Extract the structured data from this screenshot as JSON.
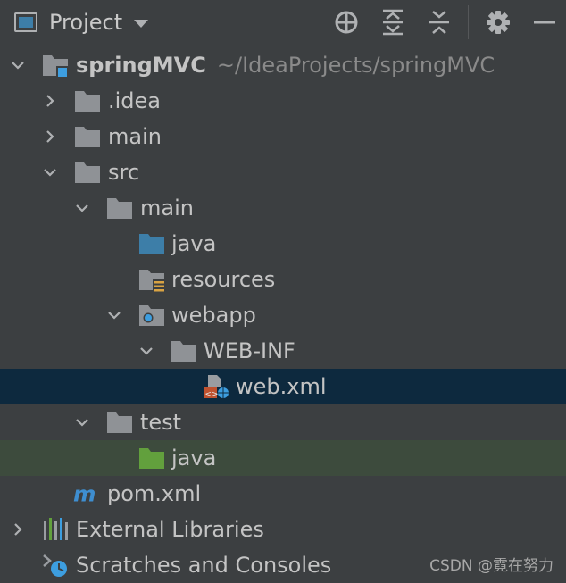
{
  "header": {
    "title": "Project",
    "icons": [
      "locate-icon",
      "expand-all-icon",
      "collapse-all-icon",
      "gear-icon",
      "minimize-icon"
    ]
  },
  "tree": [
    {
      "label": "springMVC",
      "path": "~/IdeaProjects/springMVC",
      "icon": "module-folder-icon",
      "expanded": true
    },
    {
      "label": ".idea",
      "icon": "folder-icon",
      "expanded": false
    },
    {
      "label": "main",
      "icon": "folder-icon",
      "expanded": false
    },
    {
      "label": "src",
      "icon": "folder-icon",
      "expanded": true
    },
    {
      "label": "main",
      "icon": "folder-icon",
      "expanded": true
    },
    {
      "label": "java",
      "icon": "source-folder-icon"
    },
    {
      "label": "resources",
      "icon": "resources-folder-icon"
    },
    {
      "label": "webapp",
      "icon": "web-folder-icon",
      "expanded": true
    },
    {
      "label": "WEB-INF",
      "icon": "folder-icon",
      "expanded": true
    },
    {
      "label": "web.xml",
      "icon": "web-xml-icon",
      "selected": true
    },
    {
      "label": "test",
      "icon": "folder-icon",
      "expanded": true
    },
    {
      "label": "java",
      "icon": "test-folder-icon"
    },
    {
      "label": "pom.xml",
      "icon": "maven-icon"
    },
    {
      "label": "External Libraries",
      "icon": "libraries-icon",
      "expanded": false
    },
    {
      "label": "Scratches and Consoles",
      "icon": "scratches-icon"
    }
  ],
  "watermark": "CSDN @霓在努力",
  "colors": {
    "background": "#3c3f41",
    "selection": "#0d293e",
    "highlight": "#3d4b3d",
    "folder": "#8f9296",
    "source_folder": "#3d7ea8",
    "test_folder": "#62a03d",
    "maven": "#3e8ed0"
  }
}
